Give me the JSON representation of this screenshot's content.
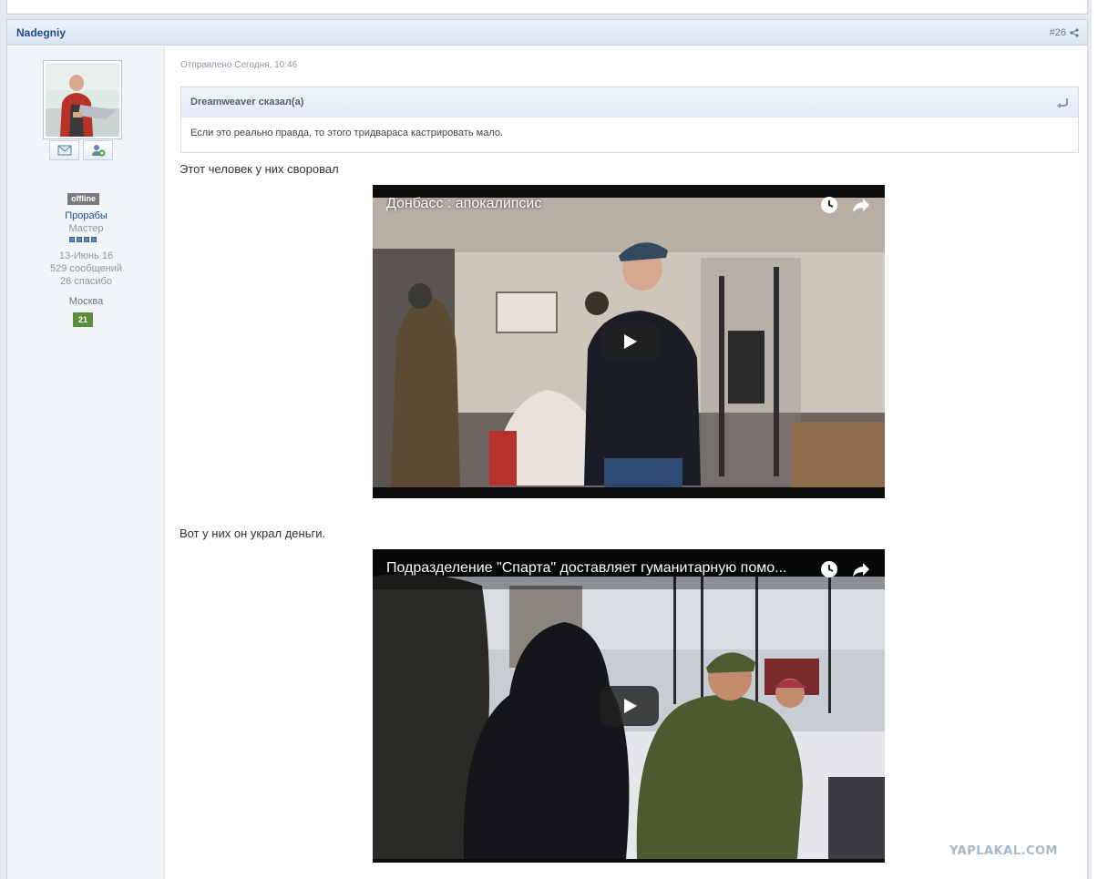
{
  "post": {
    "author": "Nadegniy",
    "number": "#26",
    "date": "Отправлено Сегодня, 10:46"
  },
  "user": {
    "status": "offline",
    "group": "Прорабы",
    "rank": "Мастер",
    "rank_pips": 4,
    "joined": "13-Июнь 16",
    "posts": "529 сообщений",
    "thanks": "26 спасибо",
    "city": "Москва",
    "reputation": "21"
  },
  "quote": {
    "author": "Dreamweaver сказал(а)",
    "text": "Если это реально правда, то этого тридвараса кастрировать мало."
  },
  "content": {
    "line1": "Этот человек у них своровал",
    "line2": "Вот у них он украл деньги."
  },
  "videos": [
    {
      "title": "Донбасс : апокалипсис"
    },
    {
      "title": "Подразделение \"Спарта\" доставляет гуманитарную помо..."
    }
  ],
  "site": {
    "watermark": "YAPLAKAL.COM"
  },
  "icons": {
    "share": "share-icon",
    "mail": "envelope-icon",
    "add_friend": "user-add-icon",
    "quote_reply": "reply-arrow-icon",
    "watch_later": "clock-icon",
    "video_share": "share-arrow-icon",
    "play": "play-icon"
  },
  "colors": {
    "link": "#1e4e8c",
    "header_bg": "#d9e5f3",
    "reputation": "#5c8c3e",
    "offline": "#7b7b7b"
  }
}
